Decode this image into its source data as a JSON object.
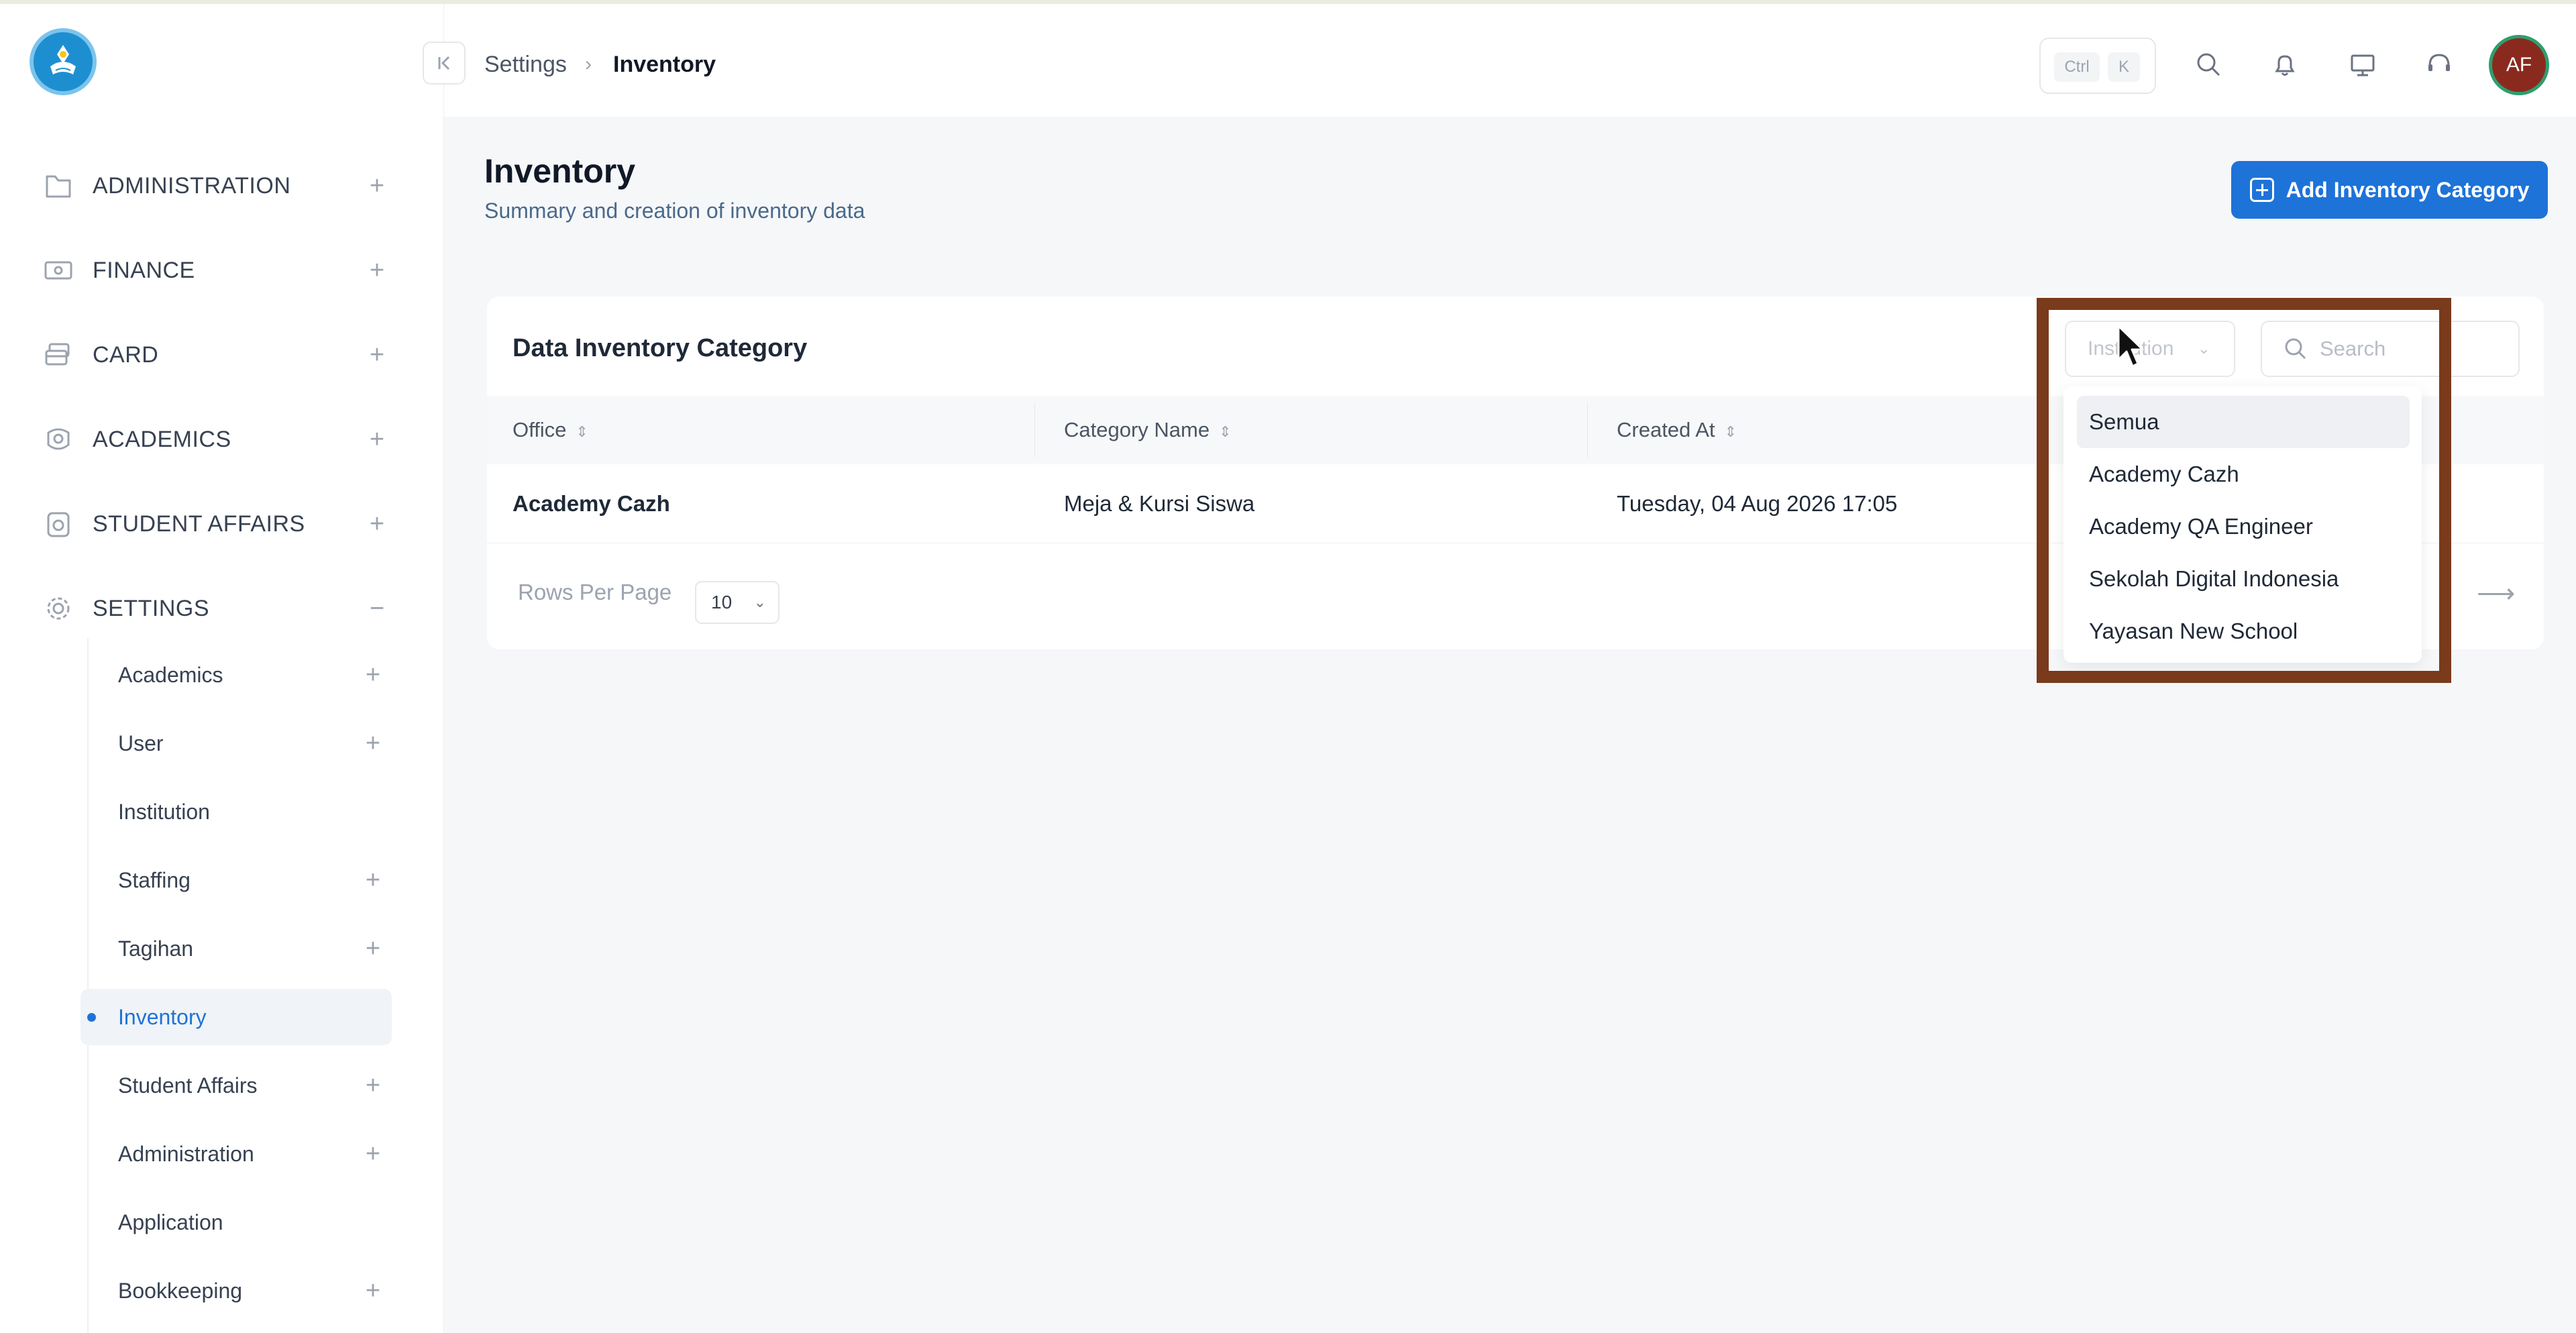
{
  "header": {
    "breadcrumb": [
      "Settings",
      "Inventory"
    ],
    "breadcrumb_sep": "›",
    "shortcut_keys": [
      "Ctrl",
      "K"
    ],
    "avatar_initials": "AF",
    "icons": [
      "collapse-sidebar-icon",
      "search-icon",
      "bell-icon",
      "monitor-icon",
      "support-icon"
    ]
  },
  "sidebar": {
    "top_items": [
      {
        "label": "ADMINISTRATION",
        "icon": "folder-icon",
        "toggle": "+"
      },
      {
        "label": "FINANCE",
        "icon": "money-icon",
        "toggle": "+"
      },
      {
        "label": "CARD",
        "icon": "card-icon",
        "toggle": "+"
      },
      {
        "label": "ACADEMICS",
        "icon": "academics-icon",
        "toggle": "+"
      },
      {
        "label": "STUDENT AFFAIRS",
        "icon": "student-affairs-icon",
        "toggle": "+"
      },
      {
        "label": "SETTINGS",
        "icon": "gear-icon",
        "toggle": "−"
      }
    ],
    "settings_items": [
      {
        "label": "Academics",
        "toggle": "+"
      },
      {
        "label": "User",
        "toggle": "+"
      },
      {
        "label": "Institution",
        "toggle": ""
      },
      {
        "label": "Staffing",
        "toggle": "+"
      },
      {
        "label": "Tagihan",
        "toggle": "+"
      },
      {
        "label": "Inventory",
        "toggle": ""
      },
      {
        "label": "Student Affairs",
        "toggle": "+"
      },
      {
        "label": "Administration",
        "toggle": "+"
      },
      {
        "label": "Application",
        "toggle": ""
      },
      {
        "label": "Bookkeeping",
        "toggle": "+"
      }
    ],
    "active_item": "Inventory"
  },
  "page": {
    "title": "Inventory",
    "subtitle": "Summary and creation of inventory data",
    "add_button_label": "Add Inventory Category"
  },
  "card": {
    "title": "Data Inventory Category",
    "institution_filter_placeholder": "Institution",
    "search_placeholder": "Search",
    "columns": [
      "Office",
      "Category Name",
      "Created At"
    ],
    "rows": [
      {
        "office": "Academy Cazh",
        "category_name": "Meja & Kursi Siswa",
        "created_at": "Tuesday, 04 Aug 2026 17:05"
      }
    ],
    "rows_per_page_label": "Rows Per Page",
    "rows_per_page_value": "10"
  },
  "institution_dropdown": {
    "options": [
      "Semua",
      "Academy Cazh",
      "Academy QA Engineer",
      "Sekolah Digital Indonesia",
      "Yayasan New School"
    ],
    "highlighted": "Semua"
  },
  "colors": {
    "primary": "#1e73d8",
    "highlight_frame": "#7a3a1c",
    "avatar_bg": "#8a2a1e"
  }
}
